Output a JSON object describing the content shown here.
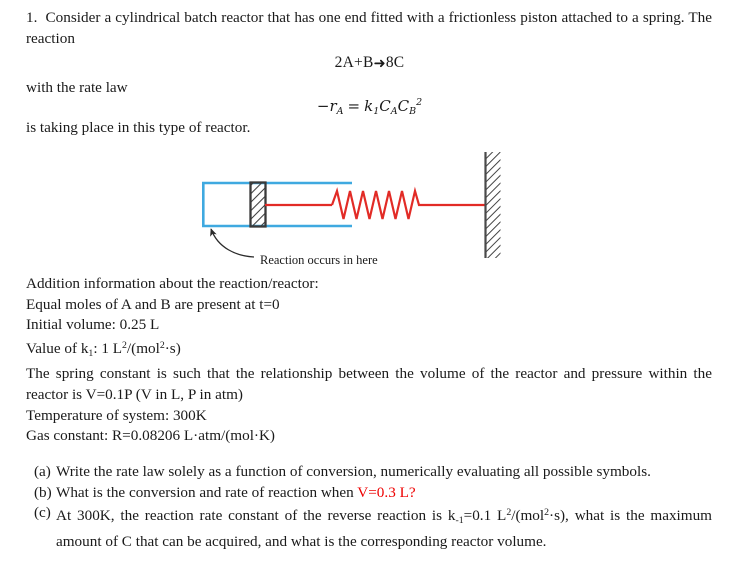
{
  "document": {
    "type": "homework-problem",
    "problem_number": "1.",
    "intro_text": "Consider a cylindrical batch reactor that has one end fitted with a frictionless piston attached to a spring. The reaction",
    "reaction_equation": {
      "left": "2A+B",
      "arrow": "➜",
      "right": "8C"
    },
    "with_rate_law_text": "with the rate law",
    "rate_law": {
      "lhs_minus": "−",
      "lhs_r": "r",
      "lhs_sub": "A",
      "equals": "=",
      "k": "k",
      "k_sub": "1",
      "ca": "C",
      "ca_sub": "A",
      "cb": "C",
      "cb_sub": "B",
      "cb_sup": "2",
      "plain": "−r_A = k₁ C_A C_B²"
    },
    "taking_place_text": "is taking place in this type of reactor."
  },
  "diagram": {
    "name": "cylindrical-batch-reactor-with-spring-piston",
    "callout_label": "Reaction occurs in here",
    "colors": {
      "cylinder": "#3FA9E0",
      "spring": "#E22B26",
      "hatch": "#3a3a3a",
      "callout": "#2b2b2b"
    }
  },
  "additional_info": {
    "heading": "Addition information about the reaction/reactor:",
    "lines": [
      "Equal moles of A and B are present at t=0",
      "Initial volume: 0.25 L"
    ],
    "k_value_prefix": "Value of k",
    "k_value_sub": "1",
    "k_value_mid": ": 1 L",
    "k_value_sup1": "2",
    "k_value_mid2": "/(mol",
    "k_value_sup2": "2",
    "k_value_end": "·s)",
    "spring_constant_text": "The spring constant is such that the relationship between the volume of the reactor and pressure within the reactor is V=0.1P (V in L, P in atm)",
    "temperature_text": "Temperature of system: 300K",
    "gas_constant_text": "Gas constant: R=0.08206 L·atm/(mol·K)"
  },
  "questions": [
    {
      "marker": "(a)",
      "text": "Write the rate law solely as a function of conversion, numerically evaluating all possible symbols."
    },
    {
      "marker": "(b)",
      "text_before": "What is the conversion and rate of reaction when ",
      "highlight": "V=0.3 L?",
      "text_after": ""
    },
    {
      "marker": "(c)",
      "part1": "At 300K, the reaction rate constant of the reverse reaction is k",
      "sub": "-1",
      "part2": "=0.1 L",
      "sup1": "2",
      "part3": "/(mol",
      "sup2": "2",
      "part4": "·s), what is the maximum amount of C that can be acquired, and what is the corresponding reactor volume."
    }
  ]
}
